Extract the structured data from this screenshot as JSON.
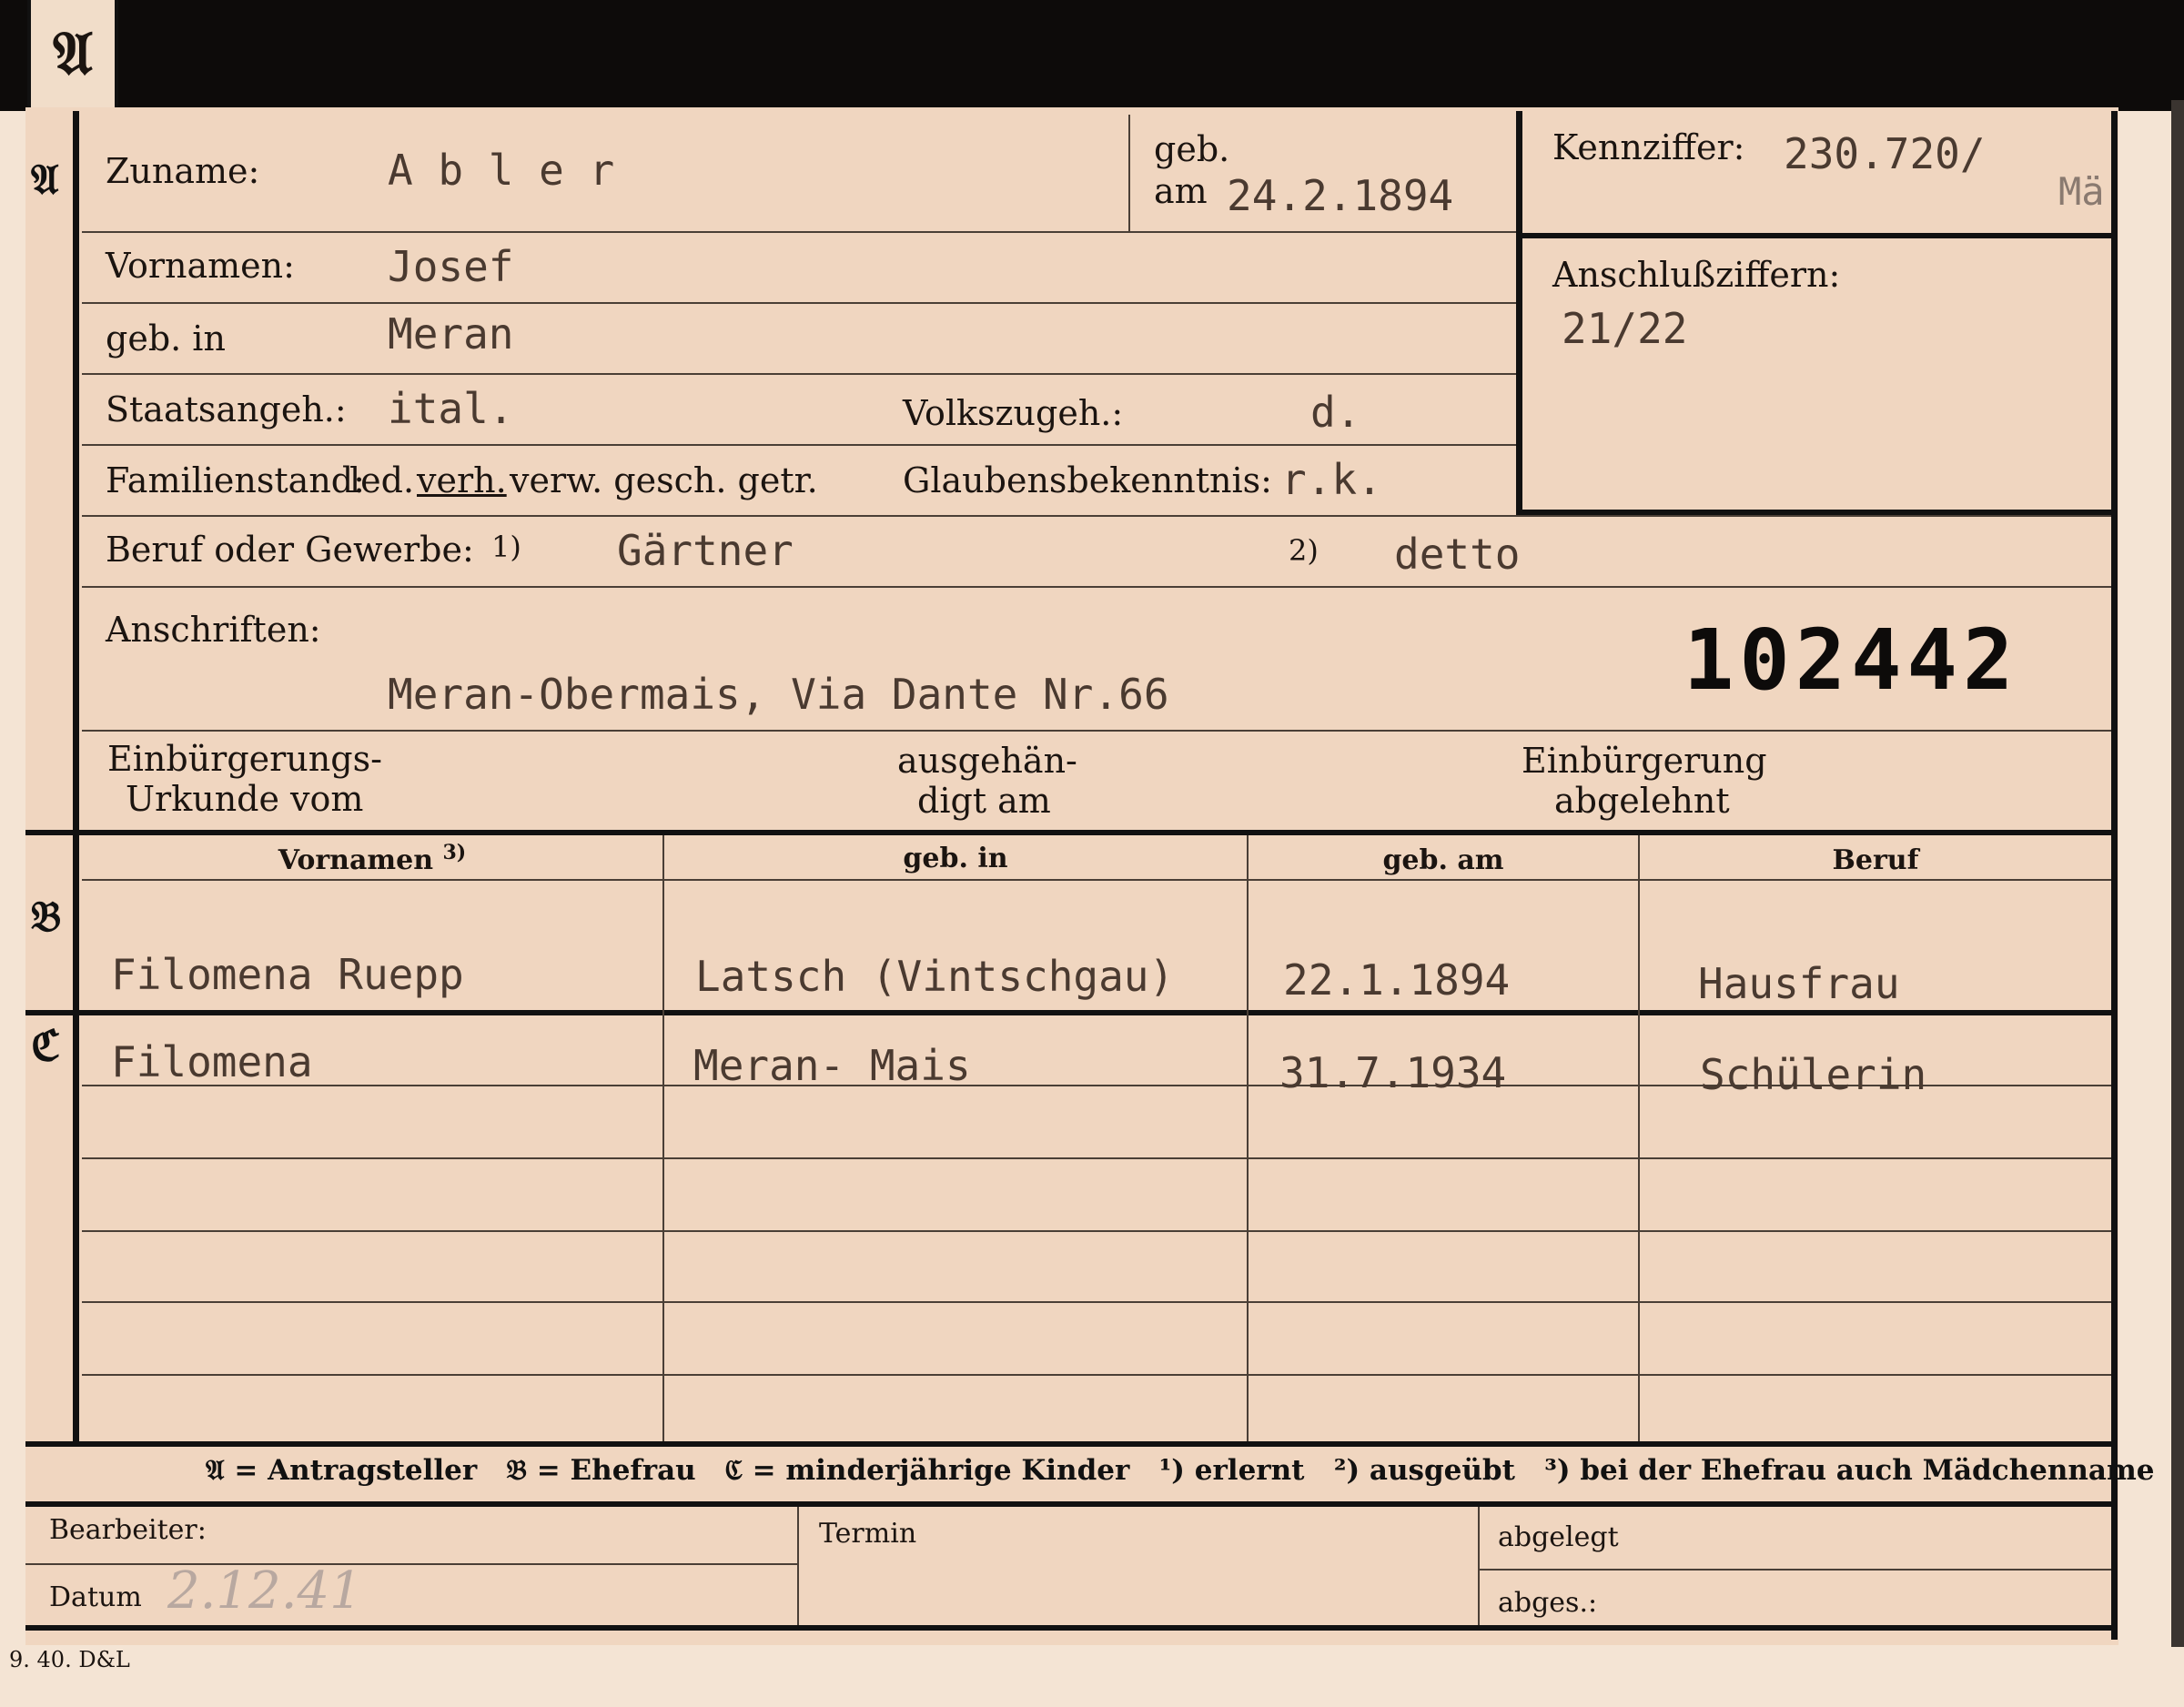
{
  "tab": {
    "letter": "𝔄"
  },
  "sections": {
    "a": "𝔄",
    "b": "𝔅",
    "c": "ℭ"
  },
  "header": {
    "surname_label": "Zuname:",
    "surname_value": "A b l e r",
    "birth_label_1": "geb.",
    "birth_label_2": "am",
    "birth_date": "24.2.1894",
    "kennziffer_label": "Kennziffer:",
    "kennziffer_value": "230.720/",
    "kennziffer_suffix": "Mä",
    "anschluss_label": "Anschlußziffern:",
    "anschluss_value": "21/22"
  },
  "person": {
    "given_label": "Vornamen:",
    "given_value": "Josef",
    "birthplace_label": "geb. in",
    "birthplace_value": "Meran",
    "citizenship_label": "Staatsangeh.:",
    "citizenship_value": "ital.",
    "ethnicity_label": "Volkszugeh.:",
    "ethnicity_value": "d.",
    "family_label": "Familienstand:",
    "family_opt_1": "led.",
    "family_opt_2": "verh.",
    "family_opt_3": "verw. gesch. getr.",
    "religion_label": "Glaubensbekenntnis:",
    "religion_value": "r.k.",
    "profession_label": "Beruf oder Gewerbe:",
    "profession_1_mark": "1)",
    "profession_1_value": "Gärtner",
    "profession_2_mark": "2)",
    "profession_2_value": "detto",
    "address_label": "Anschriften:",
    "address_value": "Meran-Obermais, Via Dante Nr.66",
    "registration_number": "102442",
    "natur_cert_label_1": "Einbürgerungs-",
    "natur_cert_label_2": "Urkunde vom",
    "handed_label_1": "ausgehän-",
    "handed_label_2": "digt am",
    "refused_label_1": "Einbürgerung",
    "refused_label_2": "abgelehnt"
  },
  "table": {
    "headers": [
      "Vornamen",
      "geb. in",
      "geb. am",
      "Beruf"
    ],
    "header_mark": "3)",
    "spouse": {
      "name": "Filomena Ruepp",
      "birthplace": "Latsch (Vintschgau)",
      "birthdate": "22.1.1894",
      "profession": "Hausfrau"
    },
    "child": {
      "name": "Filomena",
      "birthplace": "Meran- Mais",
      "birthdate": "31.7.1934",
      "profession": "Schülerin"
    }
  },
  "legend": {
    "text": "𝔄 = Antragsteller   𝔅 = Ehefrau   ℭ = minderjährige Kinder   ¹) erlernt   ²) ausgeübt   ³) bei der Ehefrau auch Mädchenname"
  },
  "footer": {
    "clerk_label": "Bearbeiter:",
    "date_label": "Datum",
    "date_value": "2.12.41",
    "term_label": "Termin",
    "filed_label": "abgelegt",
    "sent_label": "abges.:",
    "print_mark": "9. 40. D&L"
  }
}
